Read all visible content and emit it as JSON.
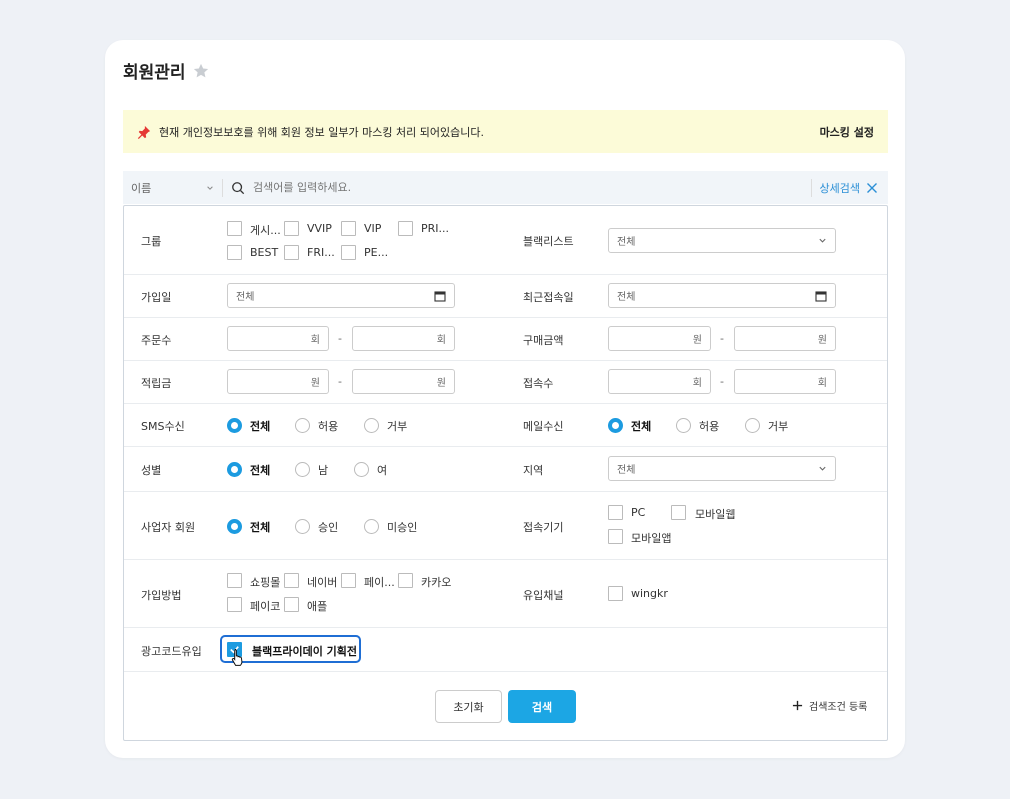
{
  "page": {
    "title": "회원관리"
  },
  "notice": {
    "text": "현재 개인정보보호를 위해 회원 정보 일부가 마스킹 처리 되어있습니다.",
    "masking_link": "마스킹 설정"
  },
  "search": {
    "field": "이름",
    "placeholder": "검색어를 입력하세요.",
    "advanced": "상세검색"
  },
  "filters": {
    "group": {
      "label": "그룹",
      "options": [
        "게시...",
        "VVIP",
        "VIP",
        "PRI...",
        "BEST",
        "FRI...",
        "PE..."
      ]
    },
    "blacklist": {
      "label": "블랙리스트",
      "value": "전체"
    },
    "join_date": {
      "label": "가입일",
      "value": "전체"
    },
    "last_login": {
      "label": "최근접속일",
      "value": "전체"
    },
    "order_count": {
      "label": "주문수",
      "unit": "회",
      "sep": "-"
    },
    "purchase_amount": {
      "label": "구매금액",
      "unit": "원",
      "sep": "-"
    },
    "points": {
      "label": "적립금",
      "unit": "원",
      "sep": "-"
    },
    "visits": {
      "label": "접속수",
      "unit": "회",
      "sep": "-"
    },
    "sms": {
      "label": "SMS수신",
      "options": [
        "전체",
        "허용",
        "거부"
      ],
      "selected": "전체"
    },
    "email": {
      "label": "메일수신",
      "options": [
        "전체",
        "허용",
        "거부"
      ],
      "selected": "전체"
    },
    "gender": {
      "label": "성별",
      "options": [
        "전체",
        "남",
        "여"
      ],
      "selected": "전체"
    },
    "region": {
      "label": "지역",
      "value": "전체"
    },
    "business": {
      "label": "사업자 회원",
      "options": [
        "전체",
        "승인",
        "미승인"
      ],
      "selected": "전체"
    },
    "device": {
      "label": "접속기기",
      "options": [
        "PC",
        "모바일웹",
        "모바일앱"
      ]
    },
    "join_method": {
      "label": "가입방법",
      "options": [
        "쇼핑몰",
        "네이버",
        "페이...",
        "카카오",
        "페이코",
        "애플"
      ]
    },
    "inflow_channel": {
      "label": "유입채널",
      "options": [
        "wingkr"
      ]
    },
    "ad_code": {
      "label": "광고코드유입",
      "option": "블랙프라이데이 기획전",
      "checked": true
    }
  },
  "actions": {
    "reset": "초기화",
    "search": "검색",
    "register": "검색조건 등록"
  },
  "colors": {
    "accent": "#1c9be0",
    "highlight": "#1f6ed4",
    "notice_bg": "#fcfbd8"
  }
}
